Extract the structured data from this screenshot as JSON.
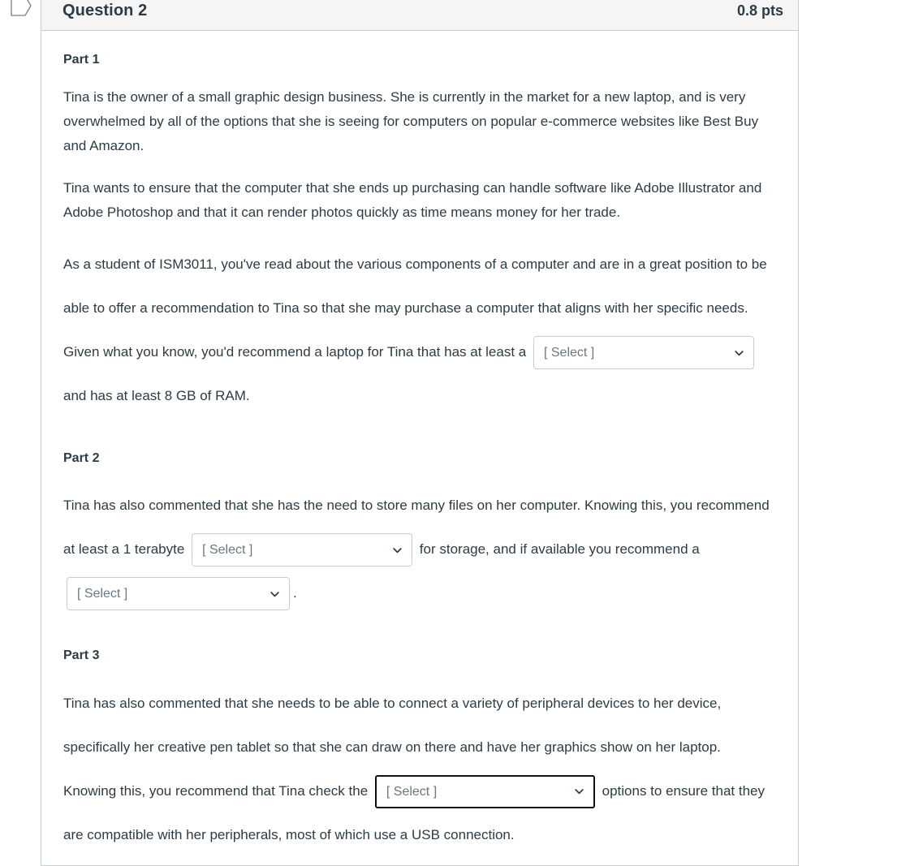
{
  "gutter": {
    "flag_icon": "flag-outline-icon"
  },
  "question": {
    "title": "Question 2",
    "points": "0.8 pts"
  },
  "parts": {
    "part1": {
      "heading": "Part 1",
      "paragraph1": "Tina is the owner of a small graphic design business. She is currently in the market for a new laptop, and is very overwhelmed by all of the options that she is seeing for computers on popular e-commerce websites like Best Buy and Amazon.",
      "paragraph2": "Tina wants to ensure that the computer that she ends up purchasing can handle software like Adobe Illustrator and Adobe Photoshop and that it can render photos quickly as time means money for her trade.",
      "paragraph3_before": "As a student of ISM3011, you've read about the various components of a computer and are in a great position to be able to offer a recommendation to Tina so that she may purchase a computer that aligns with her specific needs. Given what you know, you'd recommend a laptop for Tina that has at least a",
      "select1_value": "[ Select ]",
      "paragraph3_after": "and has at least 8 GB of RAM."
    },
    "part2": {
      "heading": "Part 2",
      "text_before_select": "Tina has also commented that she has the need to store many files on her computer. Knowing this, you recommend at least a 1 terabyte",
      "select2_value": "[ Select ]",
      "text_between_selects": "for storage, and if available you recommend a",
      "select3_value": "[ Select ]",
      "text_after_select": "."
    },
    "part3": {
      "heading": "Part 3",
      "text_before_select": "Tina has also commented that she needs to be able to connect a variety of peripheral devices to her device, specifically her creative pen tablet so that she can draw on there and have her graphics show on her laptop. Knowing this, you recommend that Tina check the",
      "select4_value": "[ Select ]",
      "text_after_select": "options to ensure that they are compatible with her peripherals, most of which use a USB connection."
    }
  },
  "icons": {
    "chevron_down": "chevron-down-icon"
  },
  "colors": {
    "header_background": "#f5f5f5",
    "border": "#c7cdd1",
    "text": "#2d3b45",
    "placeholder_text": "#6b7780",
    "focus_border": "#111111",
    "flag_icon": "#73818c"
  }
}
